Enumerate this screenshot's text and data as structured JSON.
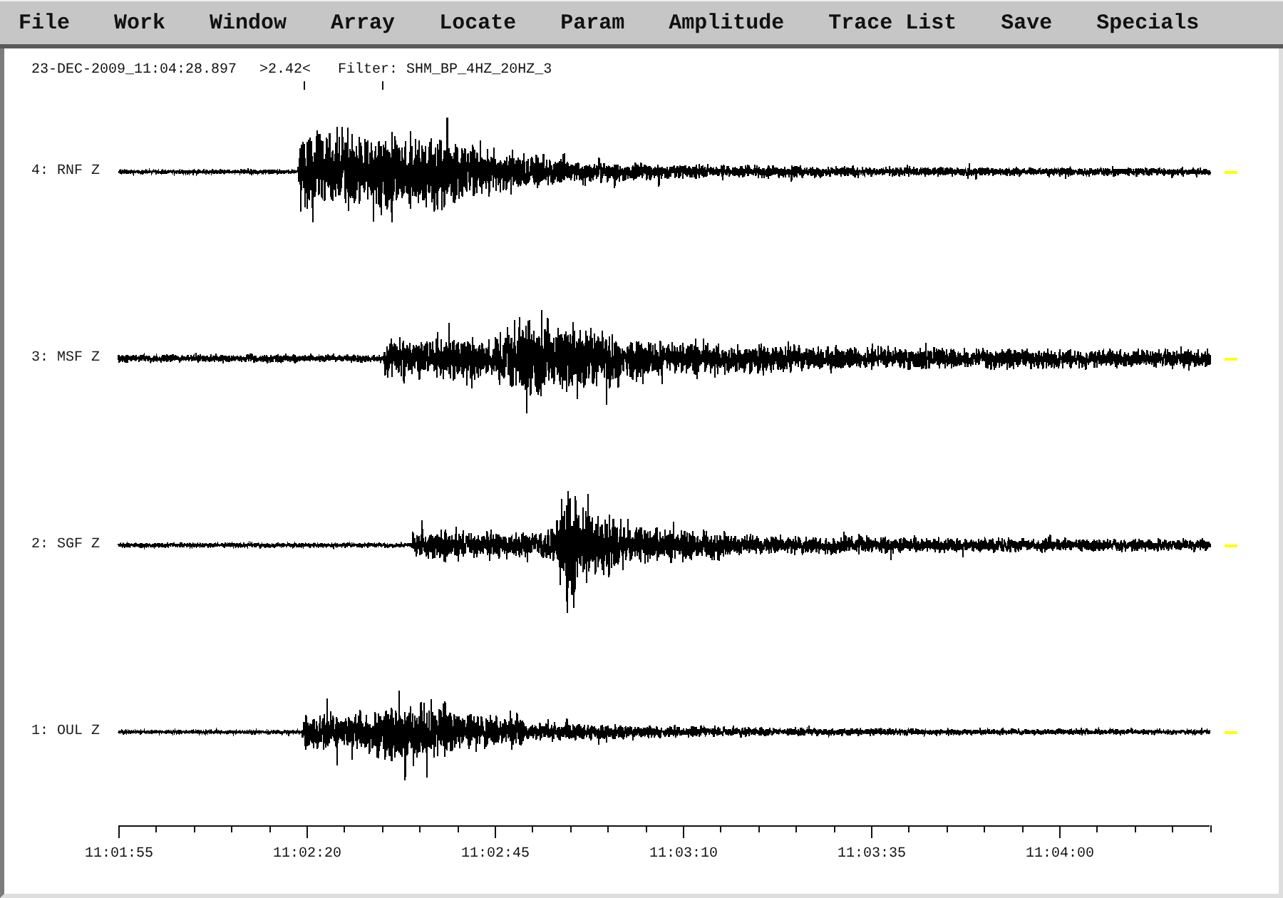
{
  "menu": [
    "File",
    "Work",
    "Window",
    "Array",
    "Locate",
    "Param",
    "Amplitude",
    "Trace List",
    "Save",
    "Specials"
  ],
  "header": {
    "timestamp": "23-DEC-2009_11:04:28.897",
    "scale": ">2.42<",
    "filter": "Filter: SHM_BP_4HZ_20HZ_3"
  },
  "traces": [
    {
      "label": "4: RNF Z"
    },
    {
      "label": "3: MSF Z"
    },
    {
      "label": "2: SGF Z"
    },
    {
      "label": "1: OUL Z"
    }
  ],
  "time_axis": {
    "tick_labels": [
      "11:01:55",
      "11:02:20",
      "11:02:45",
      "11:03:10",
      "11:03:35",
      "11:04:00"
    ]
  }
}
